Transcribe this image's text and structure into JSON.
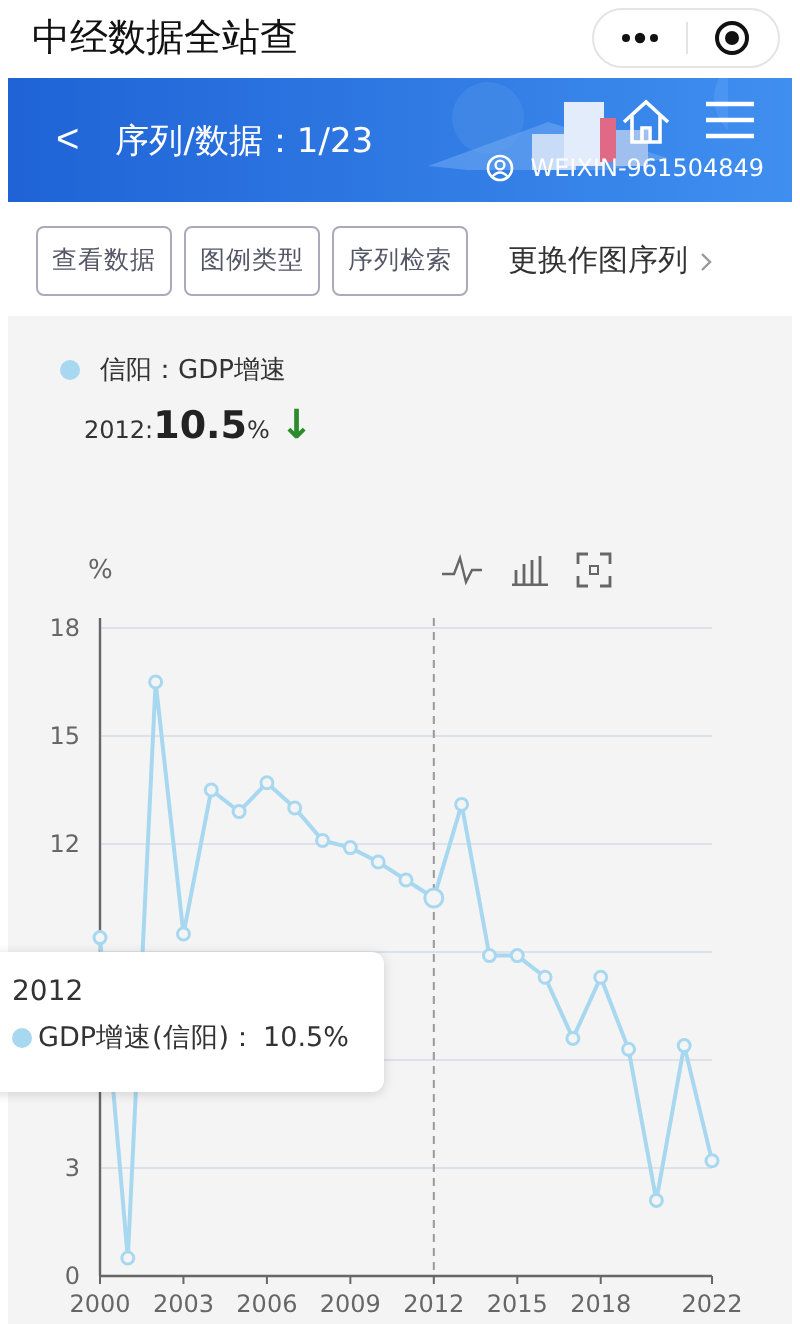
{
  "title_bar": {
    "title": "中经数据全站查"
  },
  "header": {
    "back": "<",
    "title": "序列/数据：1/23",
    "user": "WEIXIN-961504849"
  },
  "actions": [
    {
      "label": "查看数据",
      "kind": "button"
    },
    {
      "label": "图例类型",
      "kind": "button"
    },
    {
      "label": "序列检索",
      "kind": "button"
    },
    {
      "label": "更换作图序列",
      "kind": "link"
    }
  ],
  "chart": {
    "legend": "信阳：GDP增速",
    "period": "2012:",
    "value": "10.5",
    "unit": "%",
    "trend_arrow": "↓",
    "axis_unit": "%",
    "tooltip": {
      "title": "2012",
      "separator": "：",
      "value": "10.5%"
    },
    "chart_data": {
      "type": "line",
      "x": [
        2000,
        2001,
        2002,
        2003,
        2004,
        2005,
        2006,
        2007,
        2008,
        2009,
        2010,
        2011,
        2012,
        2013,
        2014,
        2015,
        2016,
        2017,
        2018,
        2019,
        2020,
        2021,
        2022
      ],
      "series": [
        {
          "name": "GDP增速(信阳)",
          "color": "#a8d8f0",
          "marker": "circle",
          "values": [
            9.4,
            0.5,
            16.5,
            9.5,
            13.5,
            12.9,
            13.7,
            13.0,
            12.1,
            11.9,
            11.5,
            11.0,
            10.5,
            13.1,
            8.9,
            8.9,
            8.3,
            6.6,
            8.3,
            6.3,
            2.1,
            6.4,
            3.2
          ]
        }
      ],
      "xlim": [
        2000,
        2022
      ],
      "ylim": [
        0,
        18
      ],
      "yticks": [
        0,
        3,
        12,
        15,
        18
      ],
      "xticks": [
        2000,
        2003,
        2006,
        2009,
        2012,
        2015,
        2018,
        2022
      ],
      "grid": true,
      "ref_lines": [
        {
          "axis": "x",
          "value": 2012,
          "color": "#999999"
        }
      ]
    }
  }
}
